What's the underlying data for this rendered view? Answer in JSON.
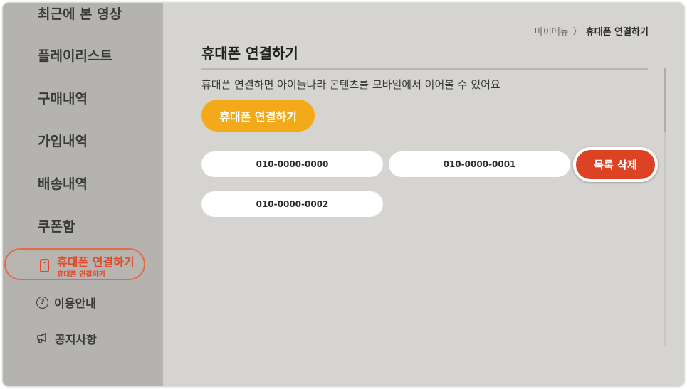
{
  "sidebar": {
    "items": [
      {
        "label": "최근에 본 영상"
      },
      {
        "label": "플레이리스트"
      },
      {
        "label": "구매내역"
      },
      {
        "label": "가입내역"
      },
      {
        "label": "배송내역"
      },
      {
        "label": "쿠폰함"
      }
    ],
    "active": {
      "label": "휴대폰 연결하기",
      "sublabel": "휴대폰 연결하기",
      "icon": "phone-icon"
    },
    "sub_items": [
      {
        "label": "이용안내",
        "icon": "help-circle-icon"
      },
      {
        "label": "공지사항",
        "icon": "megaphone-icon"
      }
    ]
  },
  "breadcrumb": {
    "parent": "마이메뉴",
    "separator": "〉",
    "current": "휴대폰 연결하기"
  },
  "main": {
    "title": "휴대폰 연결하기",
    "description": "휴대폰 연결하면 아이들나라 콘텐츠를 모바일에서 이어볼 수 있어요",
    "connect_button": "휴대폰 연결하기",
    "phones": [
      "010-0000-0000",
      "010-0000-0001",
      "010-0000-0002"
    ],
    "delete_button": "목록 삭제"
  },
  "colors": {
    "accent_orange": "#f2aa1a",
    "active_red": "#e0482a",
    "delete_red": "#dc4325"
  }
}
